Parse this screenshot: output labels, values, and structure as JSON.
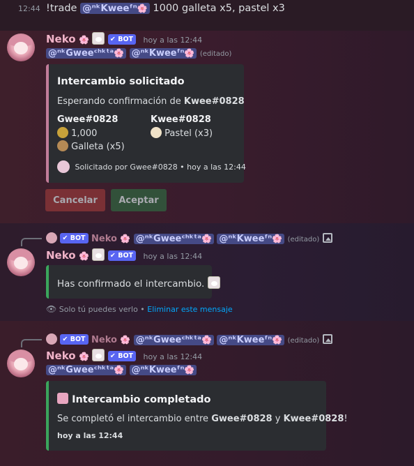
{
  "command": {
    "timestamp": "12:44",
    "text_prefix": "!trade",
    "mention": "@ⁿᵏKweeᶠⁿ",
    "flower": "🌸",
    "text_suffix": "1000 galleta x5, pastel x3"
  },
  "message1": {
    "username": "Neko",
    "flower": "🌸",
    "bot_label": "BOT",
    "time": "hoy a las 12:44",
    "mention_a": "@ⁿᵏGweeᶜʰᵏᵗᵃ",
    "mention_b": "@ⁿᵏKweeᶠⁿ",
    "edited": "(editado)",
    "embed": {
      "title": "Intercambio solicitado",
      "desc_prefix": "Esperando confirmación de",
      "desc_user": "Kwee#0828",
      "field1_name": "Gwee#0828",
      "field1_line1": "1,000",
      "field1_line2": "Galleta (x5)",
      "field2_name": "Kwee#0828",
      "field2_line1": "Pastel (x3)",
      "footer": "Solicitado por Gwee#0828 • hoy a las 12:44"
    },
    "buttons": {
      "cancel": "Cancelar",
      "accept": "Aceptar"
    }
  },
  "message2": {
    "reply": {
      "bot_label": "BOT",
      "username": "Neko",
      "mention_a": "@ⁿᵏGweeᶜʰᵏᵗᵃ",
      "mention_b": "@ⁿᵏKweeᶠⁿ",
      "edited": "(editado)"
    },
    "username": "Neko",
    "bot_label": "BOT",
    "time": "hoy a las 12:44",
    "embed_text": "Has confirmado el intercambio.",
    "ephemeral_text": "Solo tú puedes verlo •",
    "ephemeral_link": "Eliminar este mensaje"
  },
  "message3": {
    "reply": {
      "bot_label": "BOT",
      "username": "Neko",
      "mention_a": "@ⁿᵏGweeᶜʰᵏᵗᵃ",
      "mention_b": "@ⁿᵏKweeᶠⁿ",
      "edited": "(editado)"
    },
    "username": "Neko",
    "bot_label": "BOT",
    "time": "hoy a las 12:44",
    "mention_a": "@ⁿᵏGweeᶜʰᵏᵗᵃ",
    "mention_b": "@ⁿᵏKweeᶠⁿ",
    "embed": {
      "title": "Intercambio completado",
      "desc_prefix": "Se completó el intercambio entre",
      "user_a": "Gwee#0828",
      "conj": "y",
      "user_b": "Kwee#0828",
      "exclaim": "!",
      "footer": "hoy a las 12:44"
    }
  }
}
